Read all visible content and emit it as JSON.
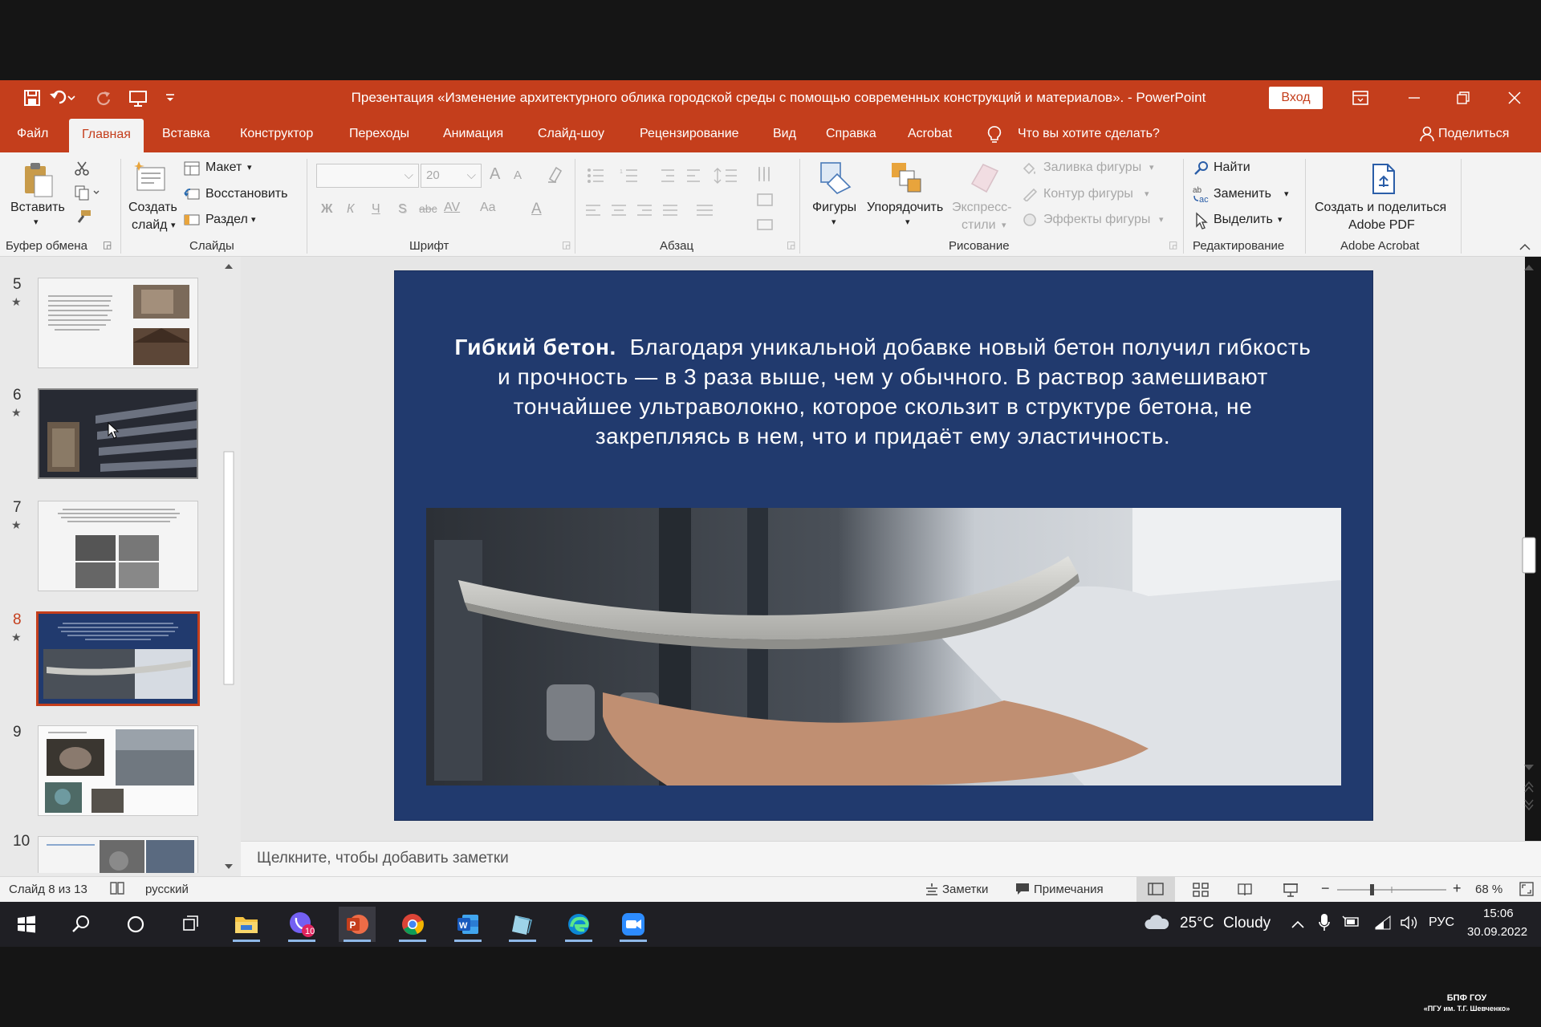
{
  "window": {
    "title": "Презентация «Изменение архитектурного облика городской среды с помощью современных конструкций и материалов». -  PowerPoint",
    "signin_label": "Вход"
  },
  "tabs": [
    {
      "label": "Файл"
    },
    {
      "label": "Главная"
    },
    {
      "label": "Вставка"
    },
    {
      "label": "Конструктор"
    },
    {
      "label": "Переходы"
    },
    {
      "label": "Анимация"
    },
    {
      "label": "Слайд-шоу"
    },
    {
      "label": "Рецензирование"
    },
    {
      "label": "Вид"
    },
    {
      "label": "Справка"
    },
    {
      "label": "Acrobat"
    },
    {
      "label": "Что вы хотите сделать?"
    },
    {
      "label": "Поделиться"
    }
  ],
  "active_tab": "Главная",
  "ribbon": {
    "clipboard": {
      "paste": "Вставить",
      "group": "Буфер обмена"
    },
    "slides": {
      "new_slide_1": "Создать",
      "new_slide_2": "слайд",
      "layout": "Макет",
      "reset": "Восстановить",
      "section": "Раздел",
      "group": "Слайды"
    },
    "font": {
      "size": "20",
      "bold": "Ж",
      "italic": "К",
      "underline": "Ч",
      "shadow": "S",
      "strike": "abc",
      "spacing": "AV",
      "case": "Aa",
      "color": "A",
      "grow": "A",
      "shrink": "A",
      "group": "Шрифт"
    },
    "paragraph": {
      "group": "Абзац"
    },
    "drawing": {
      "shapes": "Фигуры",
      "arrange": "Упорядочить",
      "quick_styles_1": "Экспресс-",
      "quick_styles_2": "стили",
      "fill": "Заливка фигуры",
      "outline": "Контур фигуры",
      "effects": "Эффекты фигуры",
      "group": "Рисование"
    },
    "editing": {
      "find": "Найти",
      "replace": "Заменить",
      "select": "Выделить",
      "group": "Редактирование"
    },
    "acrobat": {
      "create_1": "Создать и поделиться",
      "create_2": "Adobe PDF",
      "group": "Adobe Acrobat"
    }
  },
  "thumbnails": [
    {
      "num": "5",
      "star": "★"
    },
    {
      "num": "6",
      "star": "★"
    },
    {
      "num": "7",
      "star": "★"
    },
    {
      "num": "8",
      "star": "★"
    },
    {
      "num": "9",
      "star": ""
    },
    {
      "num": "10",
      "star": ""
    }
  ],
  "current_slide_num": "8",
  "slide": {
    "heading": "Гибкий бетон.",
    "body": "Благодаря уникальной добавке новый бетон получил гибкость и прочность — в 3 раза выше, чем у обычного. В раствор замешивают тончайшее ультраволокно, которое скользит в структуре бетона, не закрепляясь в нем, что и придаёт ему эластичность.",
    "background_color": "#213a6e"
  },
  "notes_placeholder": "Щелкните, чтобы добавить заметки",
  "status": {
    "slide_counter": "Слайд 8 из 13",
    "language": "русский",
    "notes": "Заметки",
    "comments": "Примечания",
    "zoom": "68 %",
    "zoom_level": 0.68
  },
  "taskbar": {
    "viber_badge": "10",
    "weather_temp": "25°C",
    "weather_text": "Cloudy",
    "lang": "РУС",
    "time": "15:06",
    "date": "30.09.2022"
  },
  "watermark": {
    "line1": "БПФ ГОУ",
    "line2": "«ПГУ им. Т.Г. Шевченко»"
  },
  "colors": {
    "accent": "#c43e1c",
    "ribbon": "#f3f3f3",
    "taskbar": "#1f1f24"
  }
}
